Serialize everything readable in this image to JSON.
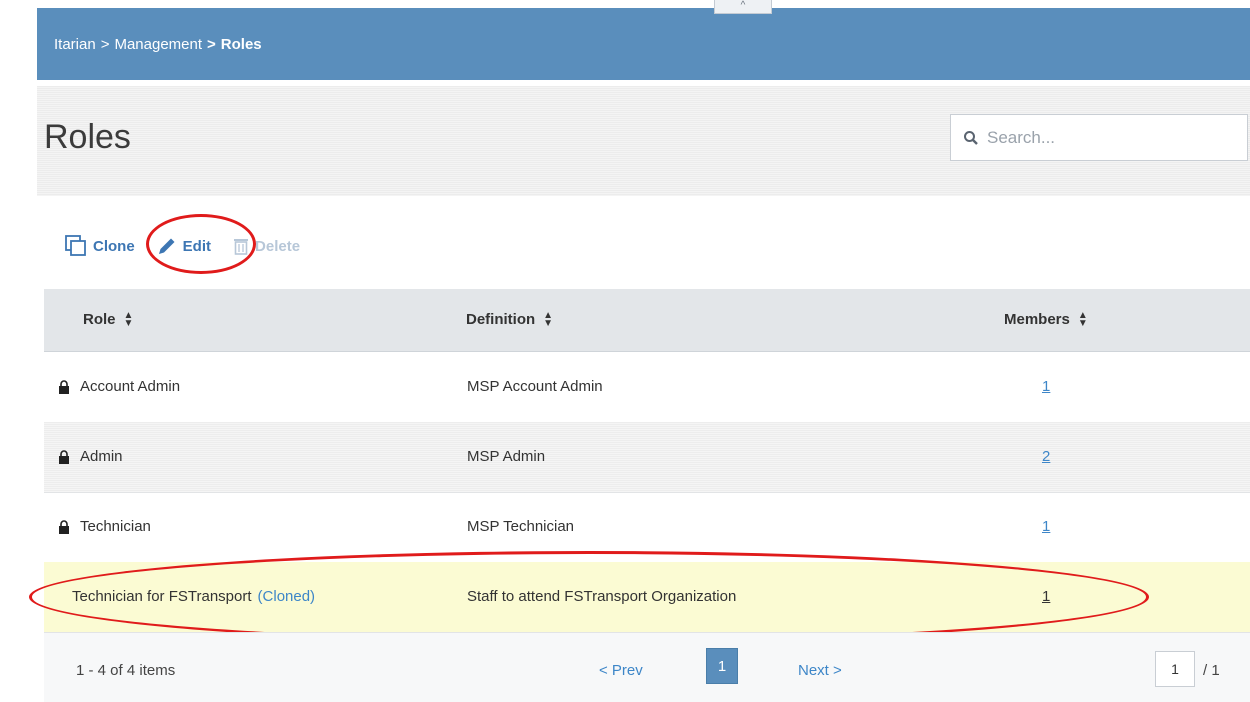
{
  "breadcrumb": {
    "items": [
      "Itarian",
      "Management"
    ],
    "separator": ">",
    "current": "Roles"
  },
  "collapse_label": "^",
  "page_title": "Roles",
  "search": {
    "placeholder": "Search..."
  },
  "toolbar": {
    "clone_label": "Clone",
    "edit_label": "Edit",
    "delete_label": "Delete"
  },
  "table": {
    "columns": [
      "Role",
      "Definition",
      "Members"
    ],
    "rows": [
      {
        "role": "Account Admin",
        "locked": true,
        "definition": "MSP Account Admin",
        "members": "1"
      },
      {
        "role": "Admin",
        "locked": true,
        "definition": "MSP Admin",
        "members": "2"
      },
      {
        "role": "Technician",
        "locked": true,
        "definition": "MSP Technician",
        "members": "1"
      },
      {
        "role": "Technician for FSTransport",
        "tag": "(Cloned)",
        "locked": false,
        "definition": "Staff to attend FSTransport Organization",
        "members": "1"
      }
    ]
  },
  "pager": {
    "info": "1 - 4 of 4 items",
    "prev_label": "< Prev",
    "current_page": "1",
    "next_label": "Next >",
    "page_input": "1",
    "total_pages": "/ 1"
  },
  "colors": {
    "topbar": "#5a8ebc",
    "link": "#3d86c8",
    "highlight_row": "#fbfbd3",
    "annotation": "#e01b1b"
  }
}
